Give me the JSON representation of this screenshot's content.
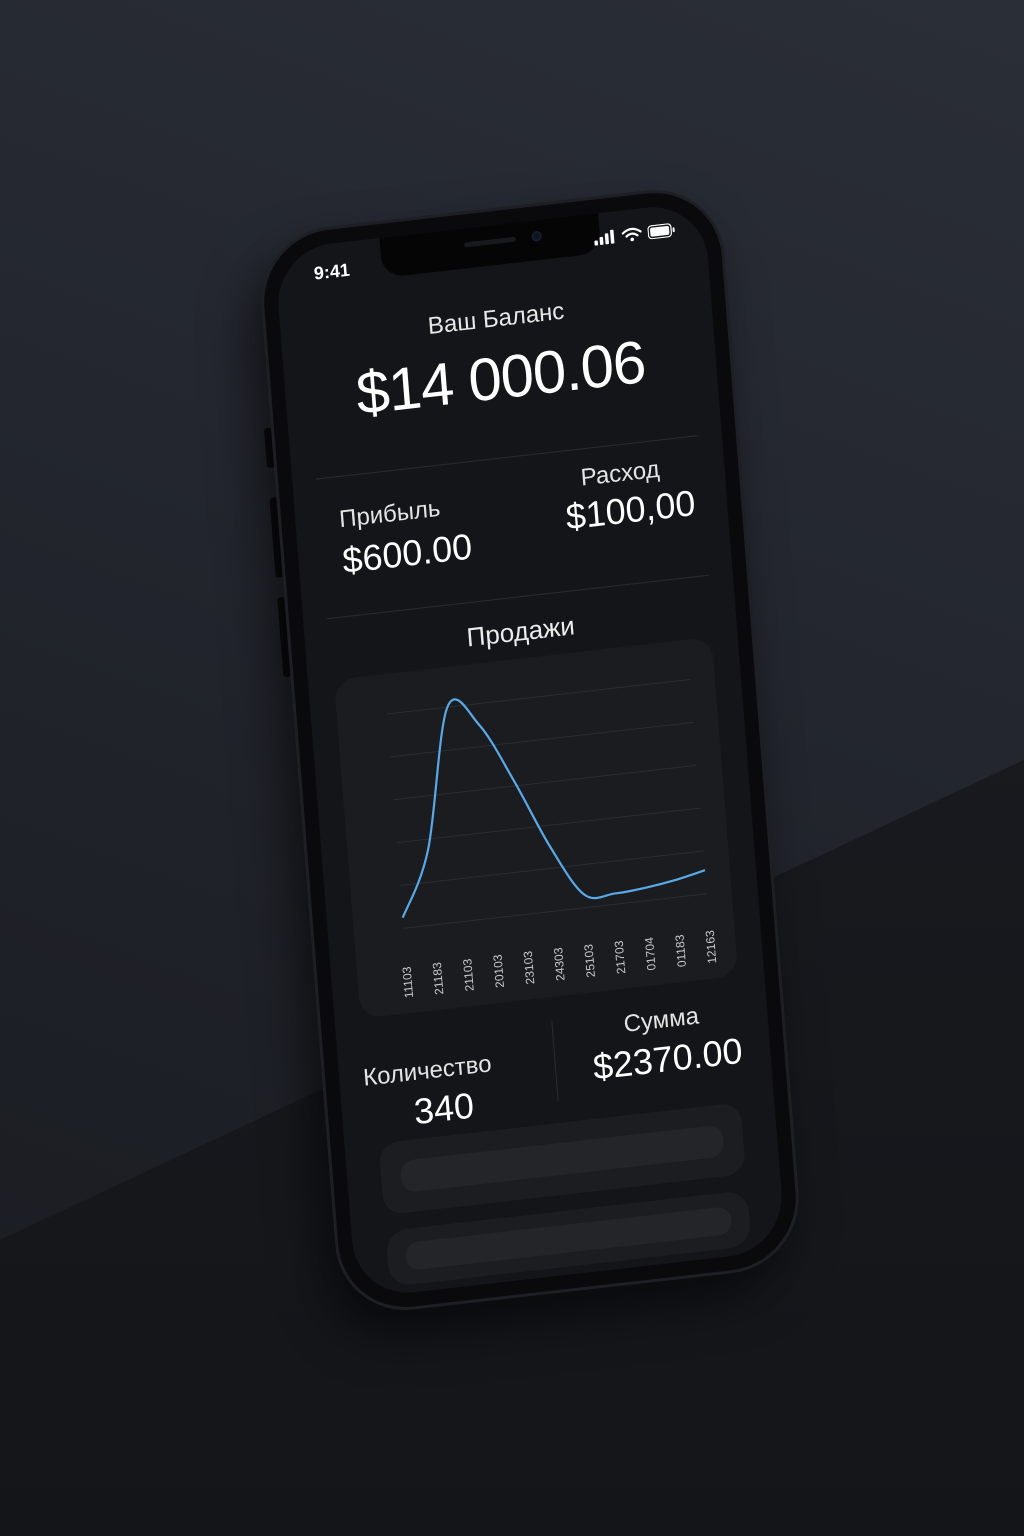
{
  "status_bar": {
    "time": "9:41"
  },
  "balance": {
    "label": "Ваш Баланс",
    "amount": "$14 000.06"
  },
  "income": {
    "label": "Прибыль",
    "amount": "$600.00"
  },
  "expense": {
    "label": "Расход",
    "amount": "$100,00"
  },
  "sales": {
    "title": "Продажи"
  },
  "quantity": {
    "label": "Количество",
    "value": "340"
  },
  "total": {
    "label": "Сумма",
    "amount": "$2370.00"
  },
  "colors": {
    "background": "#1e2026",
    "screen": "#141518",
    "card": "#1a1c20",
    "line": "#5aa9e6",
    "text": "#ffffff"
  },
  "chart_data": {
    "type": "line",
    "title": "Продажи",
    "x_tick_labels": [
      "11103",
      "21183",
      "21103",
      "20103",
      "23103",
      "24303",
      "25103",
      "21703",
      "01704",
      "01183",
      "12163"
    ],
    "grid": true,
    "series": [
      {
        "values": [
          0.05,
          0.35,
          1.0,
          0.9,
          0.62,
          0.3,
          0.06,
          0.05,
          0.06,
          0.08,
          0.11
        ]
      }
    ],
    "ylim": [
      0,
      1
    ]
  }
}
